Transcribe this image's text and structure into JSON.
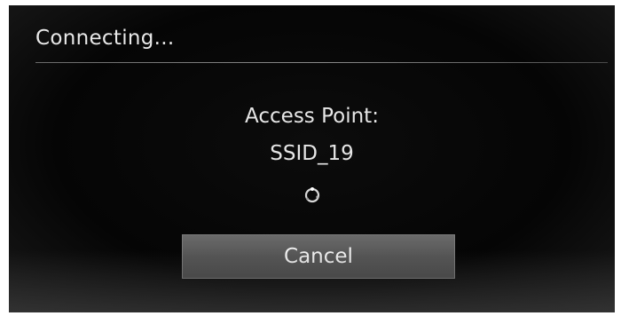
{
  "dialog": {
    "title": "Connecting...",
    "access_point_label": "Access Point:",
    "ssid": "SSID_19",
    "spinner_icon": "loading-spinner-icon",
    "cancel_label": "Cancel"
  }
}
